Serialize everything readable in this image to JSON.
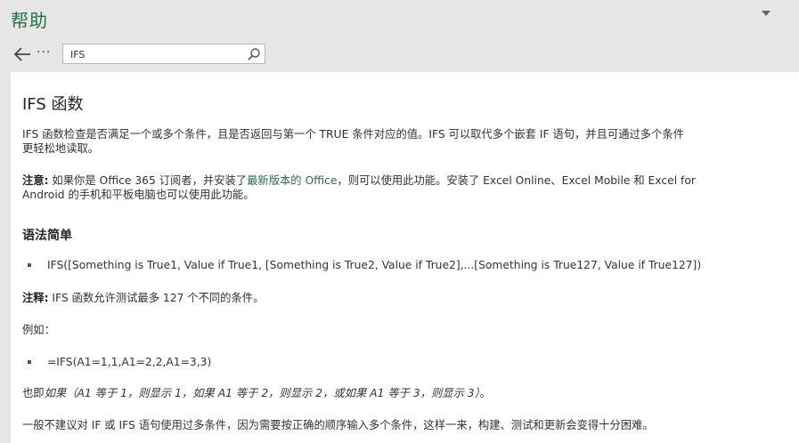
{
  "header": {
    "title": "帮助",
    "collapse_icon": "chevron-down-icon",
    "back_icon": "back-arrow-icon",
    "more_label": "···",
    "search": {
      "value": "IFS",
      "placeholder": "",
      "icon": "search-icon"
    }
  },
  "article": {
    "title": "IFS 函数",
    "intro_line1": "IFS 函数检查是否满足一个或多个条件，且是否返回与第一个 TRUE 条件对应的值。IFS 可以取代多个嵌套 IF 语句，并且可通过多个条件",
    "intro_line2": "更轻松地读取。",
    "note_label": "注意:",
    "note_part1": " 如果你是 Office 365 订阅者，并安装了",
    "note_link": "最新版本的 Office",
    "note_part2": "，则可以使用此功能。安装了 Excel Online、Excel Mobile 和 Excel for",
    "note_line2": "Android 的手机和平板电脑也可以使用此功能。",
    "syntax_heading": "语法简单",
    "syntax_item": "IFS([Something is True1, Value if True1, [Something is True2, Value if True2],...[Something is True127, Value if True127])",
    "remark_label": "注释:",
    "remark_text": " IFS 函数允许测试最多 127 个不同的条件。",
    "example_label": "例如：",
    "example_item": "=IFS(A1=1,1,A1=2,2,A1=3,3)",
    "meaning_prefix": "也即",
    "meaning_italic": "如果（A1 等于 1，则显示 1，如果 A1 等于 2，则显示 2，或如果 A1 等于 3，则显示 3）",
    "meaning_suffix": "。",
    "advice": "一般不建议对 IF 或 IFS 语句使用过多条件，因为需要按正确的顺序输入多个条件，这样一来，构建、测试和更新会变得十分困难。"
  },
  "colors": {
    "accent": "#217346",
    "background": "#e6e6e6"
  }
}
